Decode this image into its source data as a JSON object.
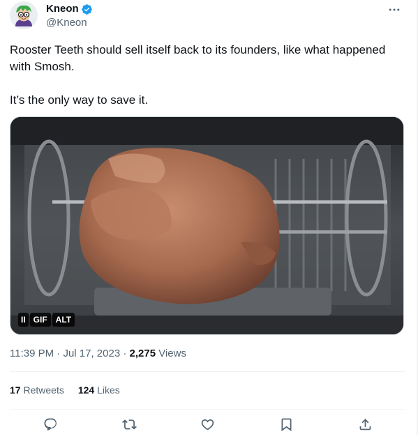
{
  "author": {
    "display_name": "Kneon",
    "handle": "@Kneon",
    "verified": true,
    "avatar_icon": "green-haired-cartoon-avatar"
  },
  "tweet": {
    "paragraphs": [
      "Rooster Teeth should sell itself back to its founders, like what happened with Smosh.",
      "It’s the only way to save it."
    ]
  },
  "media": {
    "type": "gif",
    "description_icon": "rotisserie-chicken-gif",
    "pause_label": "II",
    "gif_label": "GIF",
    "alt_label": "ALT"
  },
  "meta": {
    "time": "11:39 PM",
    "separator": " · ",
    "date": "Jul 17, 2023",
    "views_count": "2,275",
    "views_label": "Views"
  },
  "stats": {
    "retweets_count": "17",
    "retweets_label": "Retweets",
    "likes_count": "124",
    "likes_label": "Likes"
  },
  "actions": [
    "reply-icon",
    "retweet-icon",
    "like-icon",
    "bookmark-icon",
    "share-icon"
  ],
  "colors": {
    "text": "#0f1419",
    "secondary": "#536471",
    "verified": "#1d9bf0",
    "divider": "#eff3f4"
  }
}
